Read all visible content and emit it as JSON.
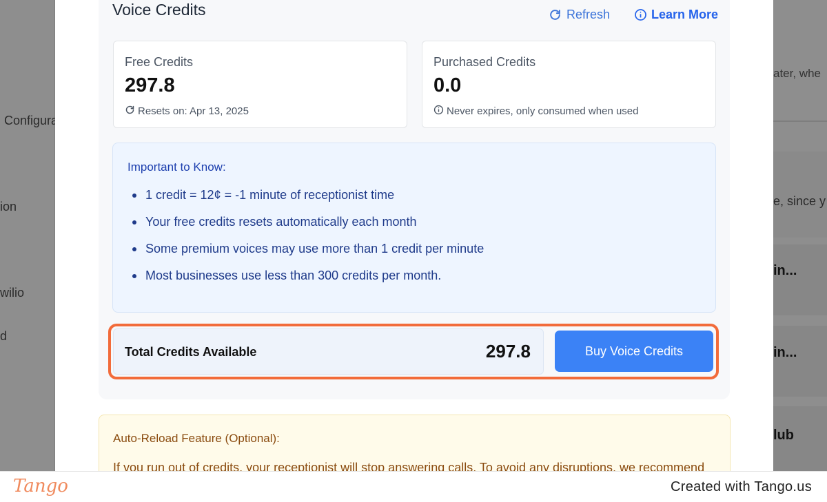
{
  "background": {
    "left_texts": [
      "Configura",
      "ion",
      "wilio",
      "d"
    ],
    "right_texts": [
      "ater, whe",
      "e, since y",
      "in...",
      "in...",
      "lub"
    ]
  },
  "voice_credits": {
    "title": "Voice Credits",
    "refresh_label": "Refresh",
    "learn_more_label": "Learn More",
    "free": {
      "label": "Free Credits",
      "value": "297.8",
      "note": "Resets on: Apr 13, 2025"
    },
    "purchased": {
      "label": "Purchased Credits",
      "value": "0.0",
      "note": "Never expires, only consumed when used"
    },
    "info": {
      "title": "Important to Know:",
      "items": [
        "1 credit = 12¢ = -1 minute of receptionist time",
        "Your free credits resets automatically each month",
        "Some premium voices may use more than 1 credit per minute",
        "Most businesses use less than 300 credits per month."
      ]
    },
    "total": {
      "label": "Total Credits Available",
      "value": "297.8"
    },
    "buy_label": "Buy Voice Credits"
  },
  "auto_reload": {
    "title": "Auto-Reload Feature (Optional):",
    "text": "If you run out of credits, your receptionist will stop answering calls. To avoid any disruptions, we recommend"
  },
  "footer": {
    "logo": "Tango",
    "text": "Created with Tango.us"
  },
  "colors": {
    "accent": "#3b82f6",
    "highlight_border": "#f26b3a",
    "info_text": "#1e3a8a"
  }
}
